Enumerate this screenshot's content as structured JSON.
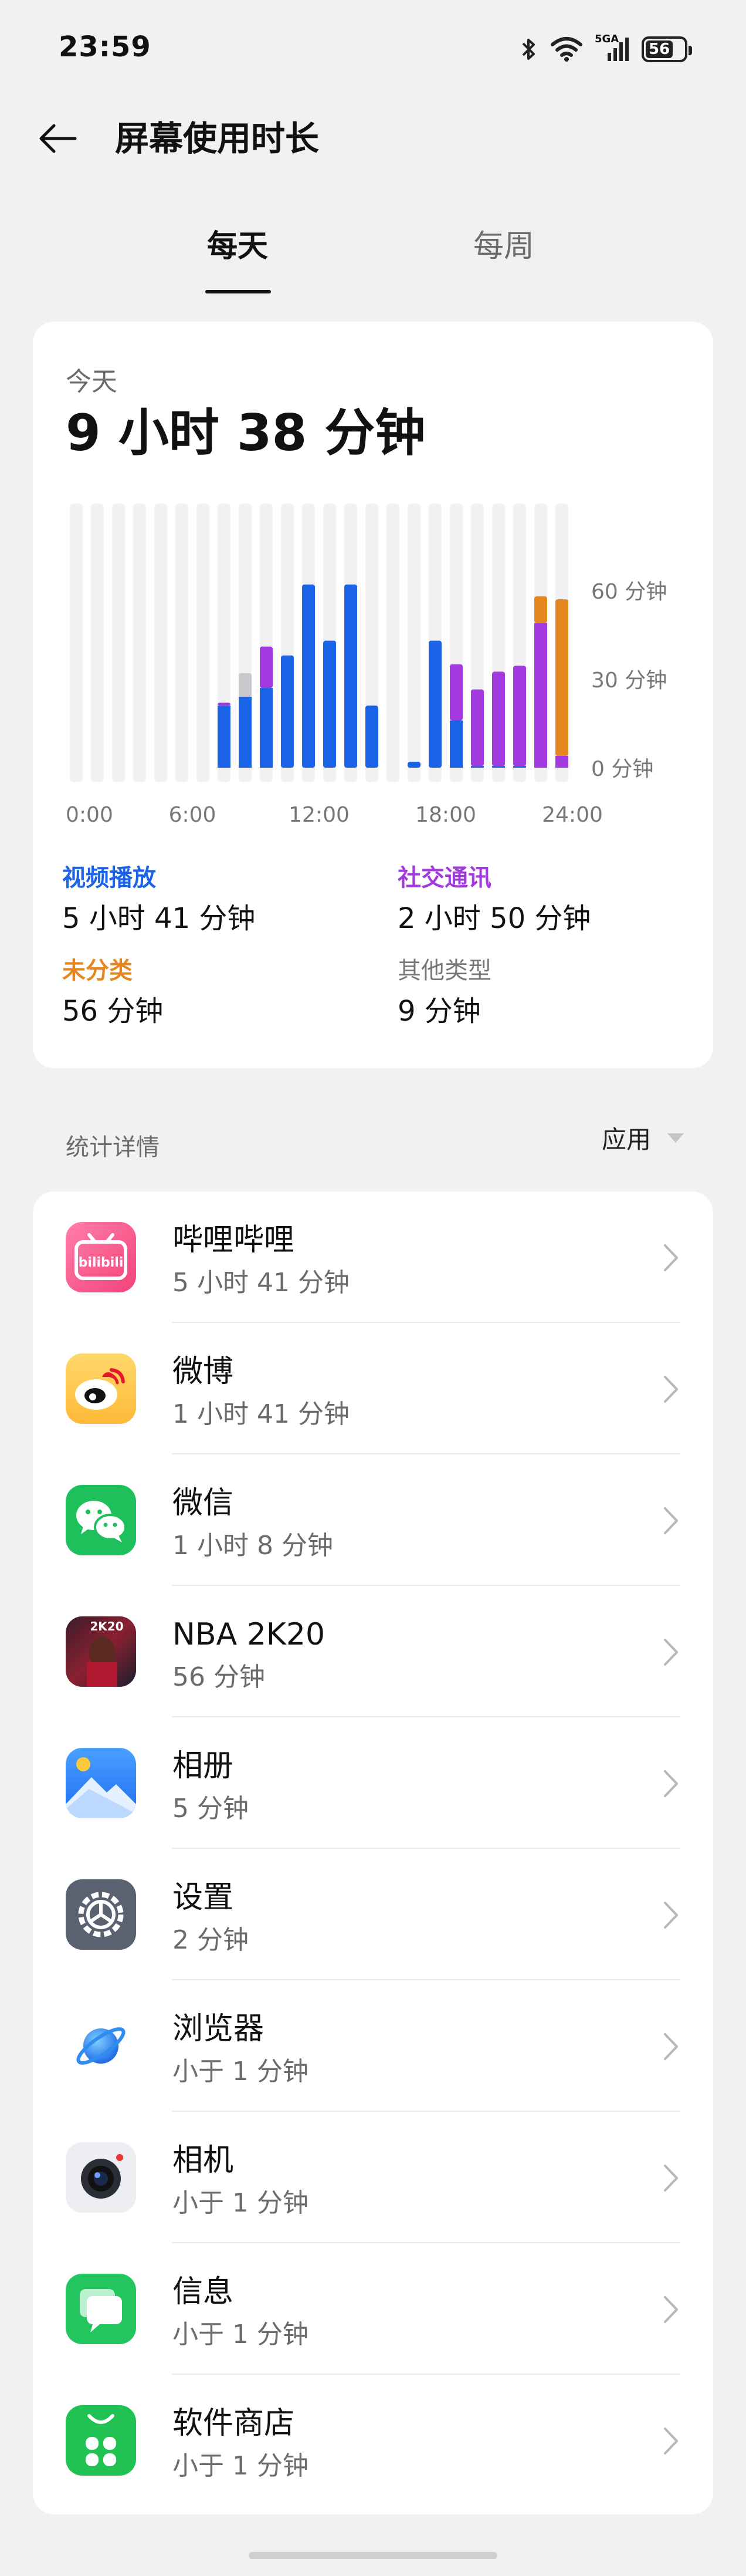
{
  "status_bar": {
    "time": "23:59",
    "battery": "56",
    "network": "5GA"
  },
  "header": {
    "title": "屏幕使用时长"
  },
  "tabs": [
    {
      "label": "每天",
      "active": true
    },
    {
      "label": "每周",
      "active": false
    }
  ],
  "summary": {
    "day_label": "今天",
    "total_time": "9 小时 38 分钟"
  },
  "chart_data": {
    "type": "bar",
    "stacked": true,
    "title": "",
    "xlabel": "",
    "ylabel": "",
    "x_tick_labels": [
      "0:00",
      "6:00",
      "12:00",
      "18:00",
      "24:00"
    ],
    "y_tick_labels": [
      "60 分钟",
      "30 分钟",
      "0 分钟"
    ],
    "ylim": [
      0,
      60
    ],
    "categories": [
      "0",
      "1",
      "2",
      "3",
      "4",
      "5",
      "6",
      "7",
      "8",
      "9",
      "10",
      "11",
      "12",
      "13",
      "14",
      "15",
      "16",
      "17",
      "18",
      "19",
      "20",
      "21",
      "22",
      "23"
    ],
    "series": [
      {
        "name": "视频播放",
        "color": "#1a62e6",
        "values": [
          0,
          0,
          0,
          0,
          0,
          0,
          0,
          21,
          24,
          27,
          38,
          0,
          0,
          0,
          0,
          0,
          0,
          0,
          0,
          0,
          0,
          0,
          0,
          0
        ]
      },
      {
        "name": "社交通讯",
        "color": "#a23ae0",
        "values": [
          0,
          0,
          0,
          0,
          0,
          0,
          0,
          1,
          0,
          14,
          0,
          0,
          0,
          0,
          0,
          0,
          0,
          0,
          0,
          0,
          0,
          0,
          0,
          0
        ]
      },
      {
        "name": "其他类型",
        "color": "#c8c8cc",
        "values": [
          0,
          0,
          0,
          0,
          0,
          0,
          0,
          0,
          8,
          0,
          0,
          0,
          0,
          0,
          0,
          0,
          0,
          0,
          0,
          0,
          0,
          0,
          0,
          0
        ]
      }
    ],
    "bar_colors_note": "per-hour stacked bars as drawn",
    "stacks": [
      [],
      [],
      [],
      [],
      [],
      [],
      [],
      [
        {
          "c": "#1a62e6",
          "v": 21
        },
        {
          "c": "#a23ae0",
          "v": 1
        }
      ],
      [
        {
          "c": "#1a62e6",
          "v": 24
        },
        {
          "c": "#c8c8cc",
          "v": 8
        }
      ],
      [
        {
          "c": "#1a62e6",
          "v": 27
        },
        {
          "c": "#a23ae0",
          "v": 14
        }
      ],
      [
        {
          "c": "#1a62e6",
          "v": 38
        }
      ],
      [
        {
          "c": "#1a62e6",
          "v": 62
        }
      ],
      [
        {
          "c": "#1a62e6",
          "v": 43
        }
      ],
      [
        {
          "c": "#1a62e6",
          "v": 62
        }
      ],
      [
        {
          "c": "#1a62e6",
          "v": 21
        }
      ],
      [],
      [
        {
          "c": "#1a62e6",
          "v": 2
        }
      ],
      [
        {
          "c": "#1a62e6",
          "v": 43
        }
      ],
      [
        {
          "c": "#1a62e6",
          "v": 16
        },
        {
          "c": "#a23ae0",
          "v": 19
        }
      ],
      [
        {
          "c": "#1a62e6",
          "v": 0.5
        },
        {
          "c": "#a23ae0",
          "v": 26
        }
      ],
      [
        {
          "c": "#1a62e6",
          "v": 0.5
        },
        {
          "c": "#a23ae0",
          "v": 32
        }
      ],
      [
        {
          "c": "#1a62e6",
          "v": 0.5
        },
        {
          "c": "#a23ae0",
          "v": 34
        }
      ],
      [
        {
          "c": "#a23ae0",
          "v": 49
        },
        {
          "c": "#e5861f",
          "v": 9
        }
      ],
      [
        {
          "c": "#a23ae0",
          "v": 4
        },
        {
          "c": "#e5861f",
          "v": 53
        }
      ]
    ]
  },
  "legend": [
    {
      "category": "视频播放",
      "value": "5 小时 41 分钟",
      "color": "#1a62e6"
    },
    {
      "category": "社交通讯",
      "value": "2 小时 50 分钟",
      "color": "#a23ae0"
    },
    {
      "category": "未分类",
      "value": "56 分钟",
      "color": "#e5861f"
    },
    {
      "category": "其他类型",
      "value": "9 分钟",
      "color": "#777777"
    }
  ],
  "details": {
    "section_label": "统计详情",
    "filter_label": "应用"
  },
  "apps": [
    {
      "name": "哔哩哔哩",
      "time": "5 小时 41 分钟",
      "icon": "bilibili-app-icon"
    },
    {
      "name": "微博",
      "time": "1 小时 41 分钟",
      "icon": "weibo-app-icon"
    },
    {
      "name": "微信",
      "time": "1 小时 8 分钟",
      "icon": "wechat-app-icon"
    },
    {
      "name": "NBA 2K20",
      "time": "56 分钟",
      "icon": "nba2k20-app-icon"
    },
    {
      "name": "相册",
      "time": "5 分钟",
      "icon": "gallery-app-icon"
    },
    {
      "name": "设置",
      "time": "2 分钟",
      "icon": "settings-app-icon"
    },
    {
      "name": "浏览器",
      "time": "小于 1 分钟",
      "icon": "browser-app-icon"
    },
    {
      "name": "相机",
      "time": "小于 1 分钟",
      "icon": "camera-app-icon"
    },
    {
      "name": "信息",
      "time": "小于 1 分钟",
      "icon": "messages-app-icon"
    },
    {
      "name": "软件商店",
      "time": "小于 1 分钟",
      "icon": "app-store-icon"
    }
  ]
}
